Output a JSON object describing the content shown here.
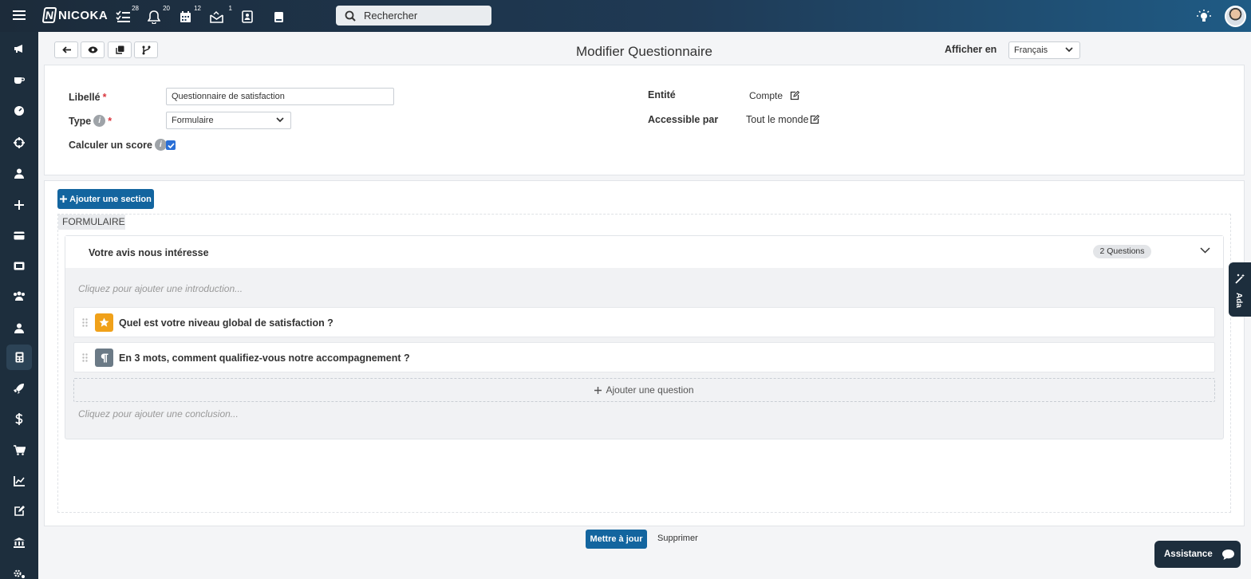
{
  "topbar": {
    "brand": "NICOKA",
    "brand_initial": "N",
    "badges": {
      "tasks": "28",
      "notifications": "20",
      "calendar": "12",
      "inbox": "1"
    },
    "search_placeholder": "Rechercher"
  },
  "toolbar": {
    "page_title": "Modifier Questionnaire",
    "show_in_label": "Afficher en",
    "language": "Français"
  },
  "form": {
    "label_label": "Libellé",
    "label_value": "Questionnaire de satisfaction",
    "type_label": "Type",
    "type_value": "Formulaire",
    "score_label": "Calculer un score",
    "score_checked": true,
    "entity_label": "Entité",
    "entity_value": "Compte",
    "access_label": "Accessible par",
    "access_value": "Tout le monde",
    "required_mark": "*",
    "info_glyph": "i"
  },
  "sections": {
    "add_section_label": "Ajouter une section",
    "form_tag": "FORMULAIRE",
    "section": {
      "title": "Votre avis nous intéresse",
      "question_count": "2 Questions",
      "intro_placeholder": "Cliquez pour ajouter une introduction...",
      "conclusion_placeholder": "Cliquez pour ajouter une conclusion...",
      "add_question_label": "Ajouter une question",
      "questions": [
        {
          "text": "Quel est votre niveau global de satisfaction ?",
          "icon": "star-icon",
          "color": "#f0a11a"
        },
        {
          "text": "En 3 mots, comment qualifiez-vous notre accompagnement ?",
          "icon": "paragraph-icon",
          "color": "#6b7a86"
        }
      ]
    }
  },
  "footer": {
    "update_label": "Mettre à jour",
    "delete_label": "Supprimer"
  },
  "widgets": {
    "ada_label": "Ada",
    "assistance_label": "Assistance"
  },
  "colors": {
    "primary": "#13659f",
    "sidebar": "#1d2e3d",
    "checkbox": "#2a6fd6",
    "required": "#d9363e"
  }
}
